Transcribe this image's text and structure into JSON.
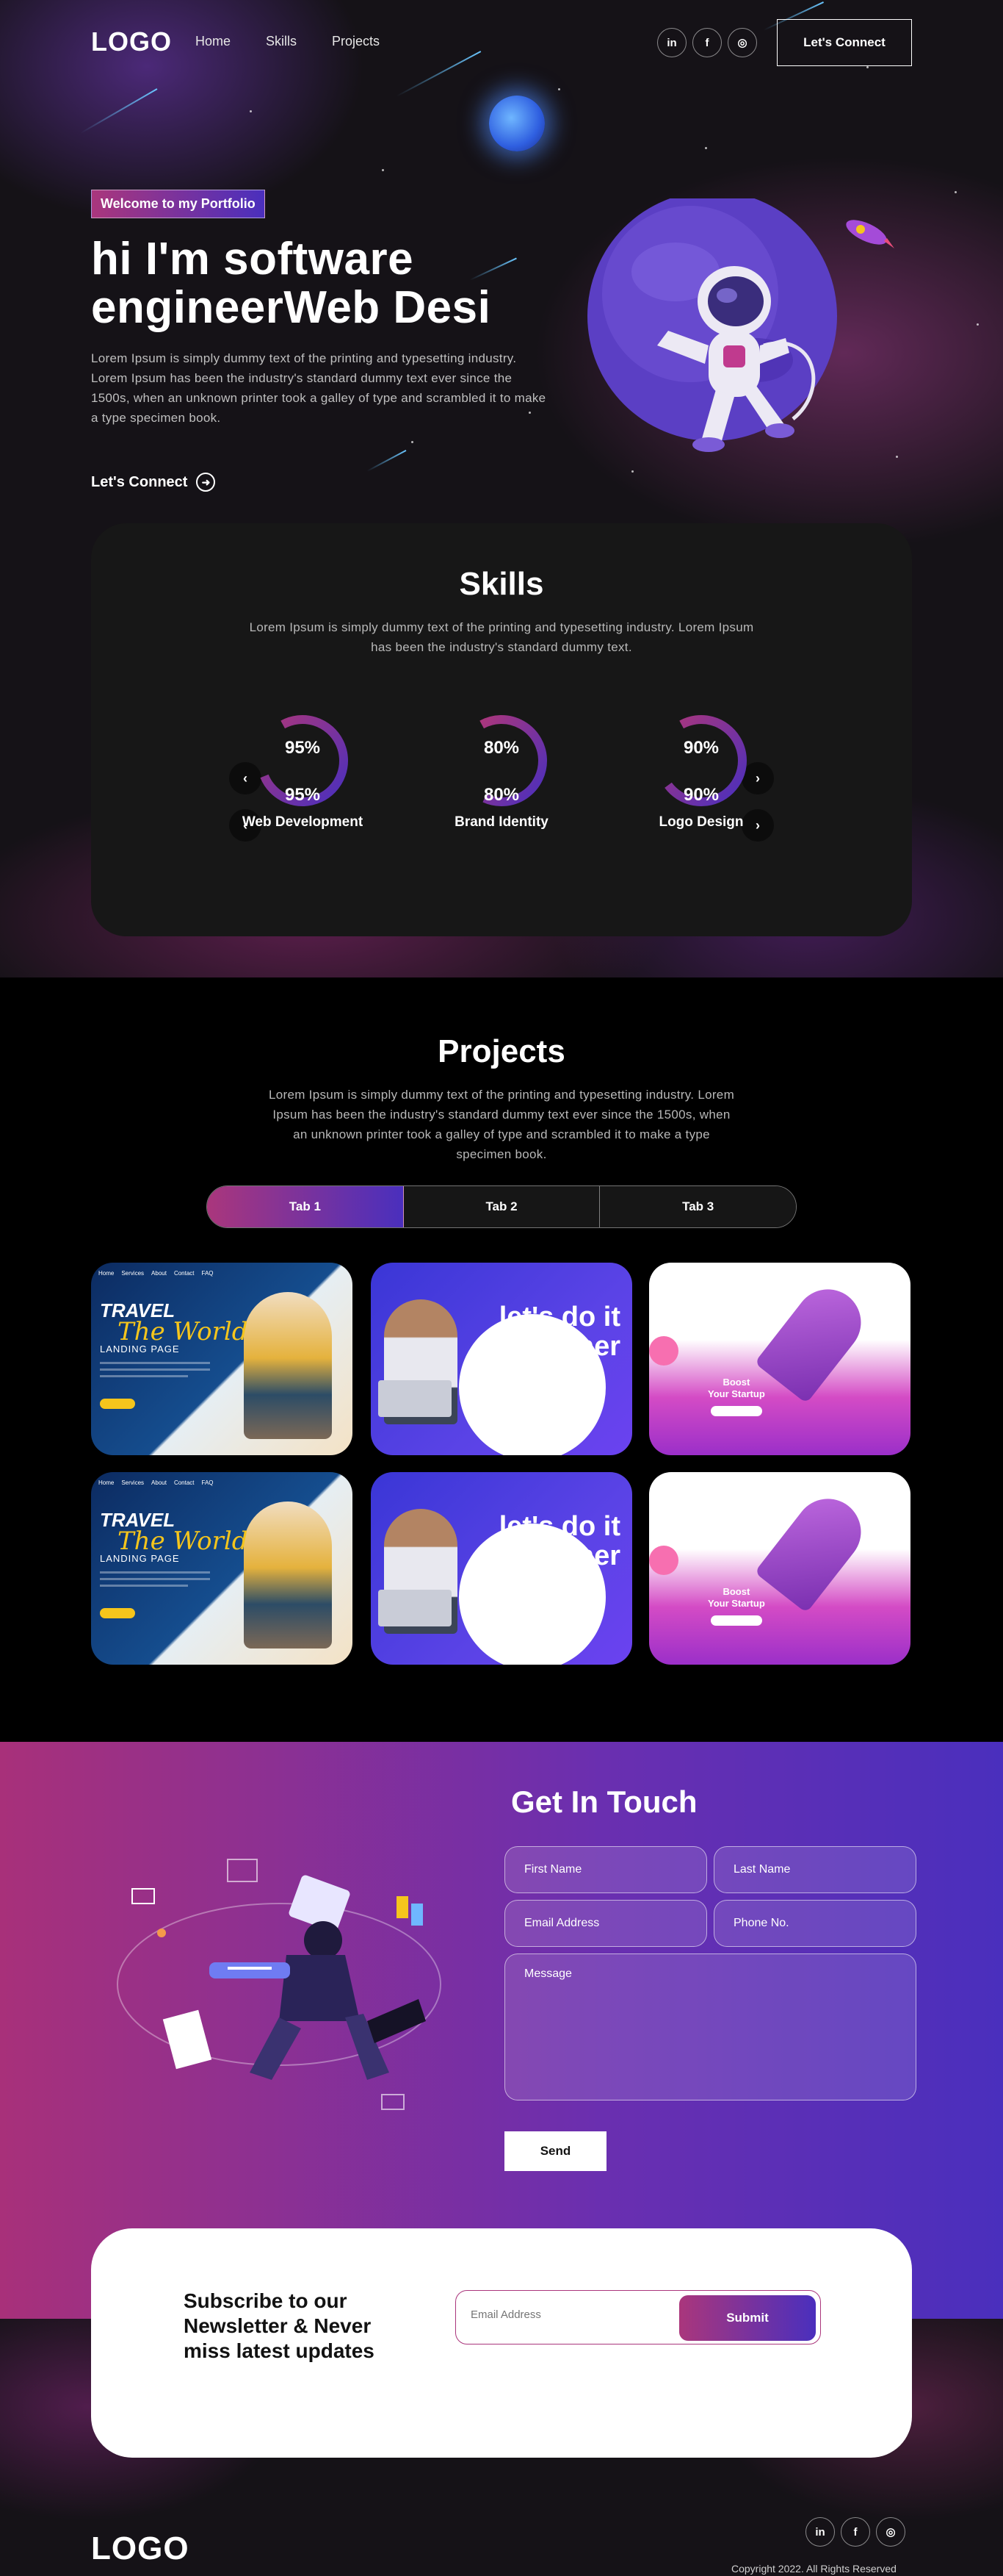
{
  "colors": {
    "accent_start": "#aa367c",
    "accent_end": "#4a2fbd",
    "bg": "#121212"
  },
  "nav": {
    "logo": "LOGO",
    "links": [
      "Home",
      "Skills",
      "Projects"
    ],
    "social": [
      {
        "icon": "linkedin-icon",
        "glyph": "in"
      },
      {
        "icon": "facebook-icon",
        "glyph": "f"
      },
      {
        "icon": "instagram-icon",
        "glyph": "◎"
      }
    ],
    "cta": "Let's Connect"
  },
  "hero": {
    "tagline": "Welcome to my Portfolio",
    "headline_line1": "hi I'm software",
    "headline_line2": "engineerWeb Desi",
    "text": "Lorem Ipsum is simply dummy text of the printing and typesetting industry. Lorem Ipsum has been the industry's standard dummy text ever since the 1500s, when an unknown printer took a galley of type and scrambled it to make a type specimen book.",
    "cta": "Let's Connect"
  },
  "skills": {
    "title": "Skills",
    "text": "Lorem Ipsum is simply dummy text of the printing and typesetting industry. Lorem Ipsum has been the industry's standard dummy text.",
    "items": [
      {
        "label": "Web Development",
        "pct_text": "95%",
        "value": 0.95
      },
      {
        "label": "Brand Identity",
        "pct_text": "80%",
        "value": 0.8
      },
      {
        "label": "Logo Design",
        "pct_text": "90%",
        "value": 0.9
      }
    ]
  },
  "projects": {
    "title": "Projects",
    "text": "Lorem Ipsum is simply dummy text of the printing and typesetting industry. Lorem Ipsum has been the industry's standard dummy text ever since the 1500s, when an unknown printer took a galley of type and scrambled it to make a type specimen book.",
    "tabs": [
      "Tab 1",
      "Tab 2",
      "Tab 3"
    ],
    "travel": {
      "title1": "TRAVEL",
      "title2": "The World",
      "sub": "LANDING PAGE",
      "nav": [
        "Home",
        "Services",
        "About",
        "Contact",
        "FAQ"
      ]
    },
    "lets": {
      "headline": "let's do it together"
    },
    "startup": {
      "headline1": "Boost",
      "headline2": "Your Startup"
    }
  },
  "contact": {
    "title": "Get In Touch",
    "fields": {
      "first_name": "First Name",
      "last_name": "Last Name",
      "email": "Email Address",
      "phone": "Phone No.",
      "message": "Message"
    },
    "send": "Send"
  },
  "newsletter": {
    "title": "Subscribe to our Newsletter & Never miss latest updates",
    "placeholder": "Email Address",
    "submit": "Submit"
  },
  "footer": {
    "logo": "LOGO",
    "copyright": "Copyright 2022. All Rights Reserved"
  }
}
